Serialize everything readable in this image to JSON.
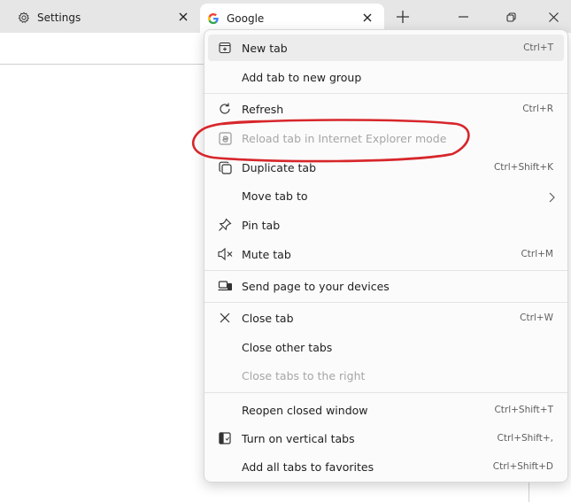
{
  "tabs": [
    {
      "title": "Settings",
      "icon": "gear-icon"
    },
    {
      "title": "Google",
      "icon": "google-g-icon"
    }
  ],
  "window_controls": [
    "minimize-icon",
    "restore-icon",
    "close-icon"
  ],
  "menu": {
    "items": [
      {
        "label": "New tab",
        "shortcut": "Ctrl+T",
        "icon": "new-tab-icon"
      },
      {
        "label": "Add tab to new group",
        "shortcut": ""
      },
      {
        "label": "Refresh",
        "shortcut": "Ctrl+R",
        "icon": "refresh-icon"
      },
      {
        "label": "Reload tab in Internet Explorer mode",
        "shortcut": "",
        "icon": "ie-mode-icon",
        "disabled": true
      },
      {
        "label": "Duplicate tab",
        "shortcut": "Ctrl+Shift+K",
        "icon": "duplicate-icon"
      },
      {
        "label": "Move tab to",
        "shortcut": ""
      },
      {
        "label": "Pin tab",
        "shortcut": "",
        "icon": "pin-icon"
      },
      {
        "label": "Mute tab",
        "shortcut": "Ctrl+M",
        "icon": "mute-icon"
      },
      {
        "label": "Send page to your devices",
        "shortcut": "",
        "icon": "send-device-icon"
      },
      {
        "label": "Close tab",
        "shortcut": "Ctrl+W",
        "icon": "close-icon"
      },
      {
        "label": "Close other tabs",
        "shortcut": ""
      },
      {
        "label": "Close tabs to the right",
        "shortcut": "",
        "disabled": true
      },
      {
        "label": "Reopen closed window",
        "shortcut": "Ctrl+Shift+T"
      },
      {
        "label": "Turn on vertical tabs",
        "shortcut": "Ctrl+Shift+,",
        "icon": "vertical-tabs-icon"
      },
      {
        "label": "Add all tabs to favorites",
        "shortcut": "Ctrl+Shift+D"
      }
    ]
  },
  "colors": {
    "tabstrip": "#e6e6e6",
    "menu_bg": "#fbfbfb",
    "annotation": "#d7262b",
    "google_blue": "#4285f4"
  }
}
